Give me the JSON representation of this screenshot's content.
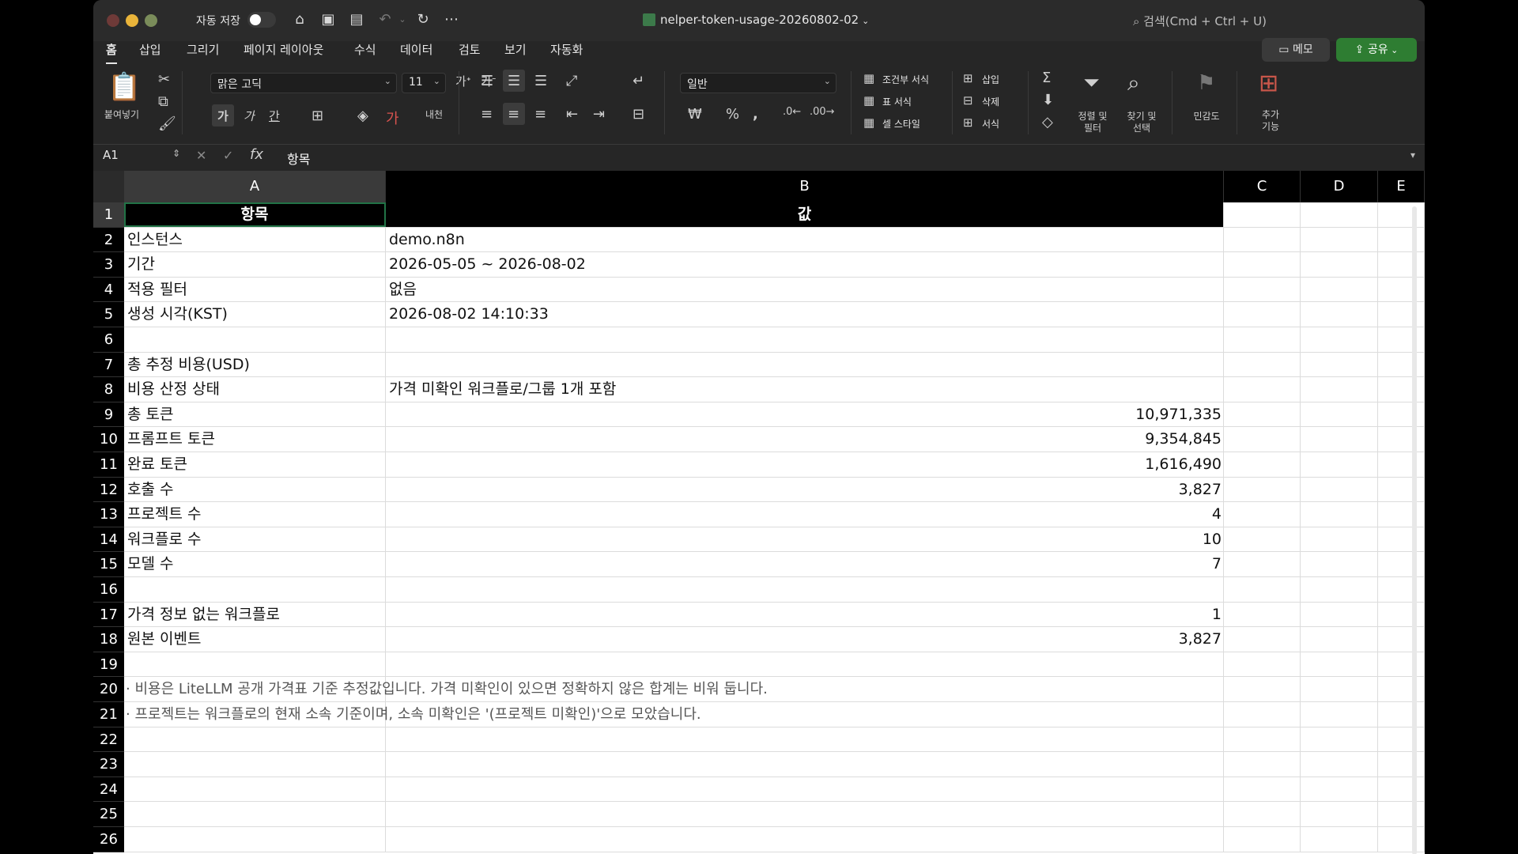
{
  "titlebar": {
    "autosave_label": "자동 저장",
    "document_title": "nelper-token-usage-20260802-02",
    "search_placeholder": "검색(Cmd + Ctrl + U)"
  },
  "menu": {
    "tabs": [
      "홈",
      "삽입",
      "그리기",
      "페이지 레이아웃",
      "수식",
      "데이터",
      "검토",
      "보기",
      "자동화"
    ],
    "memo_label": "메모",
    "share_label": "공유"
  },
  "ribbon": {
    "paste_label": "붙여넣기",
    "font_name": "맑은 고딕",
    "font_size": "11",
    "bold_label": "가",
    "italic_label": "가",
    "underline_label": "간",
    "number_format": "일반",
    "conditional_format_label": "조건부 서식",
    "table_format_label": "표 서식",
    "cell_style_label": "셀 스타일",
    "insert_label": "삽입",
    "delete_label": "삭제",
    "format_label": "서식",
    "sort_filter_label": "정렬 및\n필터",
    "find_select_label": "찾기 및\n선택",
    "sensitivity_label": "민감도",
    "addins_label": "추가\n기능"
  },
  "formula_bar": {
    "name_box": "A1",
    "value": "항목"
  },
  "columns": [
    "A",
    "B",
    "C",
    "D",
    "E"
  ],
  "rows": [
    {
      "n": "1",
      "a": "항목",
      "b": "값",
      "header": true
    },
    {
      "n": "2",
      "a": "인스턴스",
      "b": "demo.n8n"
    },
    {
      "n": "3",
      "a": "기간",
      "b": "2026-05-05 ~ 2026-08-02"
    },
    {
      "n": "4",
      "a": "적용 필터",
      "b": "없음"
    },
    {
      "n": "5",
      "a": "생성 시각(KST)",
      "b": "2026-08-02 14:10:33"
    },
    {
      "n": "6",
      "a": "",
      "b": ""
    },
    {
      "n": "7",
      "a": "총 추정 비용(USD)",
      "b": ""
    },
    {
      "n": "8",
      "a": "비용 산정 상태",
      "b": "가격 미확인 워크플로/그룹 1개 포함"
    },
    {
      "n": "9",
      "a": "총 토큰",
      "b": "10,971,335",
      "num": true
    },
    {
      "n": "10",
      "a": "프롬프트 토큰",
      "b": "9,354,845",
      "num": true
    },
    {
      "n": "11",
      "a": "완료 토큰",
      "b": "1,616,490",
      "num": true
    },
    {
      "n": "12",
      "a": "호출 수",
      "b": "3,827",
      "num": true
    },
    {
      "n": "13",
      "a": "프로젝트 수",
      "b": "4",
      "num": true
    },
    {
      "n": "14",
      "a": "워크플로 수",
      "b": "10",
      "num": true
    },
    {
      "n": "15",
      "a": "모델 수",
      "b": "7",
      "num": true
    },
    {
      "n": "16",
      "a": "",
      "b": ""
    },
    {
      "n": "17",
      "a": "가격 정보 없는 워크플로",
      "b": "1",
      "num": true
    },
    {
      "n": "18",
      "a": "원본 이벤트",
      "b": "3,827",
      "num": true
    },
    {
      "n": "19",
      "a": "",
      "b": ""
    },
    {
      "n": "20",
      "note": "· 비용은 LiteLLM 공개 가격표 기준 추정값입니다. 가격 미확인이 있으면 정확하지 않은 합계는 비워 둡니다."
    },
    {
      "n": "21",
      "note": "· 프로젝트는 워크플로의 현재 소속 기준이며, 소속 미확인은 '(프로젝트 미확인)'으로 모았습니다."
    },
    {
      "n": "22",
      "a": "",
      "b": ""
    },
    {
      "n": "23",
      "a": "",
      "b": ""
    },
    {
      "n": "24",
      "a": "",
      "b": ""
    },
    {
      "n": "25",
      "a": "",
      "b": ""
    },
    {
      "n": "26",
      "a": "",
      "b": ""
    }
  ]
}
